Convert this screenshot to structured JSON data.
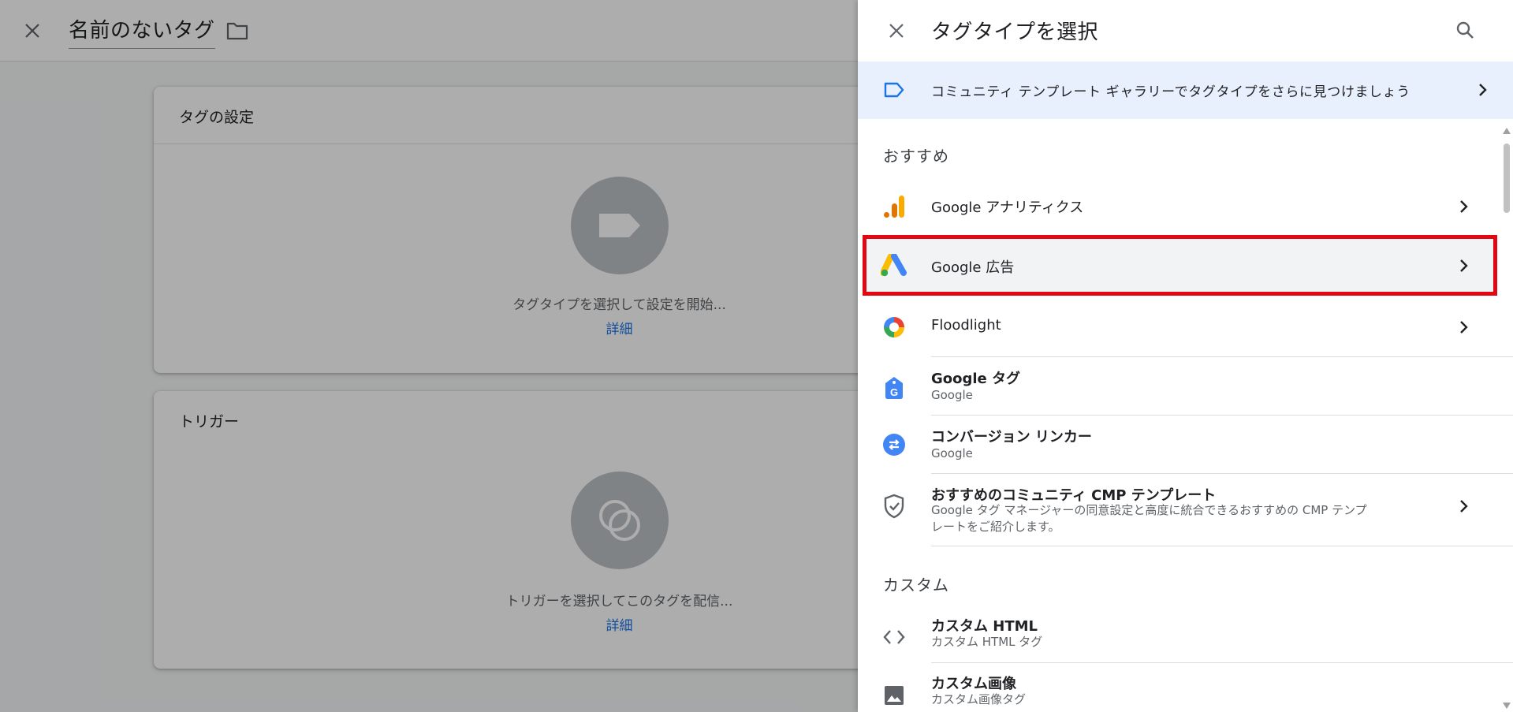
{
  "editor": {
    "tag_name": "名前のないタグ",
    "tag_config_card": {
      "title": "タグの設定",
      "hint": "タグタイプを選択して設定を開始...",
      "link": "詳細"
    },
    "trigger_card": {
      "title": "トリガー",
      "hint": "トリガーを選択してこのタグを配信...",
      "link": "詳細"
    }
  },
  "panel": {
    "title": "タグタイプを選択",
    "banner": {
      "text": "コミュニティ テンプレート ギャラリーでタグタイプをさらに見つけましょう",
      "icon": "tag-outline-icon"
    },
    "sections": {
      "recommended_label": "おすすめ",
      "custom_label": "カスタム"
    },
    "recommended_items": [
      {
        "label": "Google アナリティクス",
        "icon": "google-analytics-icon",
        "has_chevron": true
      },
      {
        "label": "Google 広告",
        "icon": "google-ads-icon",
        "has_chevron": true,
        "highlighted": true
      },
      {
        "label": "Floodlight",
        "icon": "floodlight-icon",
        "has_chevron": true
      },
      {
        "title": "Google タグ",
        "subtitle": "Google",
        "icon": "google-tag-icon"
      },
      {
        "title": "コンバージョン リンカー",
        "subtitle": "Google",
        "icon": "conversion-linker-icon"
      },
      {
        "title": "おすすめのコミュニティ CMP テンプレート",
        "subtitle_line1": "Google タグ マネージャーの同意設定と高度に統合できるおすすめの CMP テンプ",
        "subtitle_line2": "レートをご紹介します。",
        "icon": "shield-check-icon",
        "has_chevron": true
      }
    ],
    "custom_items": [
      {
        "title": "カスタム HTML",
        "subtitle": "カスタム HTML タグ",
        "icon": "code-brackets-icon"
      },
      {
        "title": "カスタム画像",
        "subtitle": "カスタム画像タグ",
        "icon": "image-icon"
      }
    ],
    "colors": {
      "highlight_border": "#e30613",
      "banner_bg": "#e8f0fe",
      "link_blue": "#1a73e8"
    }
  }
}
